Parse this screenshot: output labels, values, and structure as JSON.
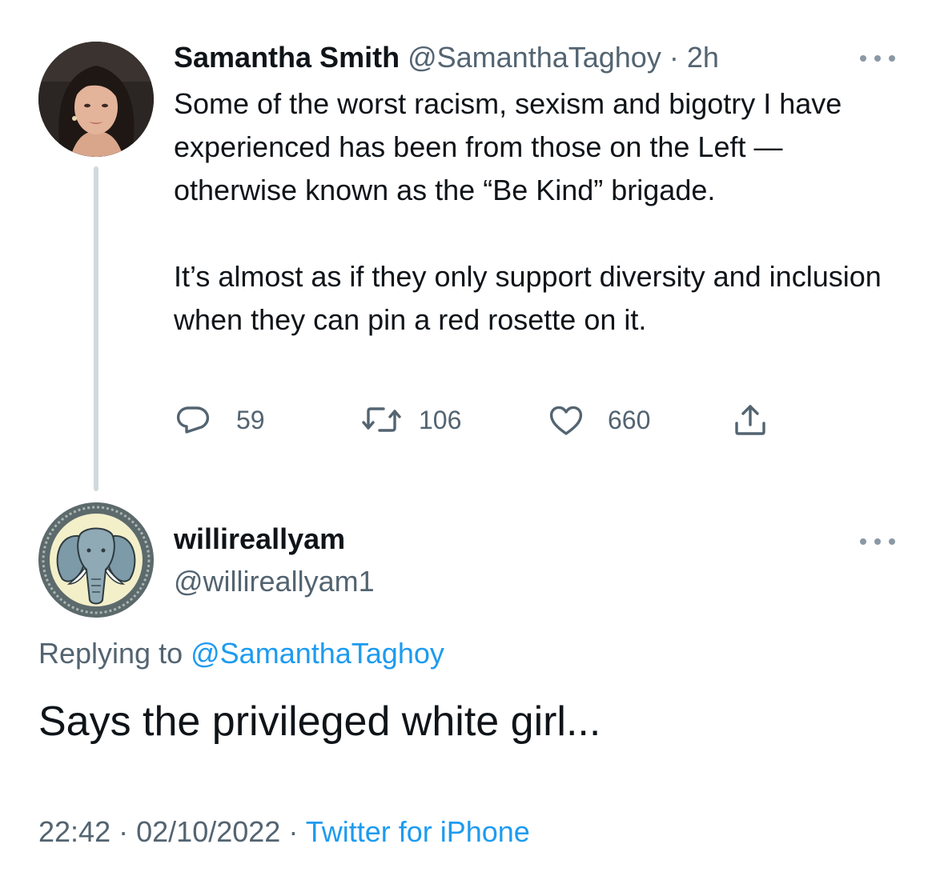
{
  "parent_tweet": {
    "display_name": "Samantha Smith",
    "handle": "@SamanthaTaghoy",
    "separator": "·",
    "time_ago": "2h",
    "avatar_icon": "profile-photo-woman",
    "text_paragraph_1": "Some of the worst racism, sexism and bigotry I have experienced has been from those on the Left — otherwise known as the “Be Kind” brigade.",
    "text_paragraph_2": "It’s almost as if they only support diversity and inclusion when they can pin a red rosette on it.",
    "reply_count": "59",
    "retweet_count": "106",
    "like_count": "660",
    "more_icon": "more-horizontal-icon"
  },
  "reply_tweet": {
    "display_name": "willireallyam",
    "handle": "@willireallyam1",
    "avatar_icon": "elephant-emblem",
    "replying_to_label": "Replying to",
    "replying_to_handle": "@SamanthaTaghoy",
    "text": "Says the privileged white girl...",
    "time": "22:42",
    "date": "02/10/2022",
    "separator": "·",
    "source": "Twitter for iPhone",
    "more_icon": "more-horizontal-icon"
  },
  "colors": {
    "text_primary": "#0f1419",
    "text_secondary": "#536471",
    "link": "#1d9bf0",
    "thread_line": "#cfd9de"
  }
}
